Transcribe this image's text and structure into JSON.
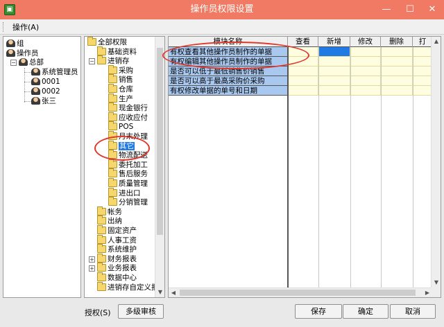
{
  "window": {
    "title": "操作员权限设置",
    "icon_text": "▣",
    "min": "—",
    "max": "☐",
    "close": "✕"
  },
  "menu": {
    "operation": "操作(A)"
  },
  "left_tree": {
    "group": "组",
    "operator": "操作员",
    "hq": "总部",
    "users": [
      "系统管理员",
      "0001",
      "0002",
      "张三"
    ]
  },
  "module_tree": {
    "root": "全部权限",
    "level1_before": [
      "基础资料",
      "进销存"
    ],
    "jxc_children": [
      "采购",
      "销售",
      "仓库",
      "生产",
      "现金银行",
      "应收应付",
      "POS",
      "月末处理",
      "其它",
      "物流配送",
      "委托加工",
      "售后服务",
      "质量管理",
      "进出口",
      "分销管理"
    ],
    "level1_after": [
      "帐务",
      "出纳",
      "固定资产",
      "人事工资",
      "系统维护",
      "财务报表",
      "业务报表",
      "数据中心",
      "进销存自定义报"
    ],
    "selected": "其它"
  },
  "grid": {
    "headers": [
      "模块名称",
      "查看",
      "新增",
      "修改",
      "删除",
      "打"
    ],
    "rows": [
      "有权查看其他操作员制作的单据",
      "有权编辑其他操作员制作的单据",
      "是否可以低于最低销售价销售",
      "是否可以高于最高采购价采购",
      "有权修改单据的单号和日期"
    ],
    "selected_cell": {
      "row": 0,
      "col": "新增"
    }
  },
  "bottom": {
    "auth_label": "授权(S)",
    "multi_review": "多级审核",
    "save": "保存",
    "ok": "确定",
    "cancel": "取消"
  },
  "colors": {
    "titlebar": "#f07a63",
    "row_highlight": "#a9c8ef",
    "cell_bg": "#fffde0",
    "selected_cell": "#1f7ae3",
    "annotation": "#e0362c"
  }
}
